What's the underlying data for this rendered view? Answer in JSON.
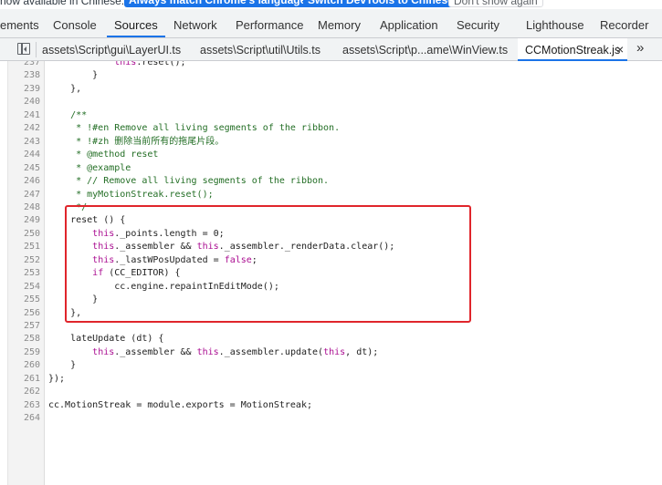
{
  "banner": {
    "text": "now available in Chinese.",
    "match_label": "Always match Chrome's language",
    "switch_label": "Switch DevTools to Chinese",
    "dismiss_label": "Don't show again"
  },
  "panel_tabs": [
    {
      "label": "ements",
      "active": false
    },
    {
      "label": "Console",
      "active": false
    },
    {
      "label": "Sources",
      "active": true
    },
    {
      "label": "Network",
      "active": false
    },
    {
      "label": "Performance",
      "active": false
    },
    {
      "label": "Memory",
      "active": false
    },
    {
      "label": "Application",
      "active": false
    },
    {
      "label": "Security",
      "active": false
    },
    {
      "label": "Lighthouse",
      "active": false
    },
    {
      "label": "Recorder",
      "active": false
    }
  ],
  "file_tabs": [
    {
      "label": "assets\\Script\\gui\\LayerUI.ts",
      "active": false
    },
    {
      "label": "assets\\Script\\util\\Utils.ts",
      "active": false
    },
    {
      "label": "assets\\Script\\p...ame\\WinView.ts",
      "active": false
    },
    {
      "label": "CCMotionStreak.js",
      "active": true
    }
  ],
  "icons": {
    "close": "×",
    "more": "»"
  },
  "code": {
    "lines": [
      {
        "num": "237",
        "segments": [
          {
            "t": "            ",
            "c": "default"
          },
          {
            "t": "this",
            "c": "keyword"
          },
          {
            "t": ".reset();",
            "c": "default"
          }
        ]
      },
      {
        "num": "238",
        "segments": [
          {
            "t": "        }",
            "c": "default"
          }
        ]
      },
      {
        "num": "239",
        "segments": [
          {
            "t": "    },",
            "c": "default"
          }
        ]
      },
      {
        "num": "240",
        "segments": []
      },
      {
        "num": "241",
        "segments": [
          {
            "t": "    /**",
            "c": "comment"
          }
        ]
      },
      {
        "num": "242",
        "segments": [
          {
            "t": "     * !#en Remove all living segments of the ribbon.",
            "c": "comment"
          }
        ]
      },
      {
        "num": "243",
        "segments": [
          {
            "t": "     * !#zh 删除当前所有的拖尾片段。",
            "c": "comment"
          }
        ]
      },
      {
        "num": "244",
        "segments": [
          {
            "t": "     * @method reset",
            "c": "comment"
          }
        ]
      },
      {
        "num": "245",
        "segments": [
          {
            "t": "     * @example",
            "c": "comment"
          }
        ]
      },
      {
        "num": "246",
        "segments": [
          {
            "t": "     * // Remove all living segments of the ribbon.",
            "c": "comment"
          }
        ]
      },
      {
        "num": "247",
        "segments": [
          {
            "t": "     * myMotionStreak.reset();",
            "c": "comment"
          }
        ]
      },
      {
        "num": "248",
        "segments": [
          {
            "t": "     */",
            "c": "comment"
          }
        ]
      },
      {
        "num": "249",
        "segments": [
          {
            "t": "    reset () {",
            "c": "default"
          }
        ]
      },
      {
        "num": "250",
        "segments": [
          {
            "t": "        ",
            "c": "default"
          },
          {
            "t": "this",
            "c": "keyword"
          },
          {
            "t": "._points.length = 0;",
            "c": "default"
          }
        ]
      },
      {
        "num": "251",
        "segments": [
          {
            "t": "        ",
            "c": "default"
          },
          {
            "t": "this",
            "c": "keyword"
          },
          {
            "t": "._assembler && ",
            "c": "default"
          },
          {
            "t": "this",
            "c": "keyword"
          },
          {
            "t": "._assembler._renderData.clear();",
            "c": "default"
          }
        ]
      },
      {
        "num": "252",
        "segments": [
          {
            "t": "        ",
            "c": "default"
          },
          {
            "t": "this",
            "c": "keyword"
          },
          {
            "t": "._lastWPosUpdated = ",
            "c": "default"
          },
          {
            "t": "false",
            "c": "keyword"
          },
          {
            "t": ";",
            "c": "default"
          }
        ]
      },
      {
        "num": "253",
        "segments": [
          {
            "t": "        ",
            "c": "default"
          },
          {
            "t": "if",
            "c": "keyword"
          },
          {
            "t": " (CC_EDITOR) {",
            "c": "default"
          }
        ]
      },
      {
        "num": "254",
        "segments": [
          {
            "t": "            cc.engine.repaintInEditMode();",
            "c": "default"
          }
        ]
      },
      {
        "num": "255",
        "segments": [
          {
            "t": "        }",
            "c": "default"
          }
        ]
      },
      {
        "num": "256",
        "segments": [
          {
            "t": "    },",
            "c": "default"
          }
        ]
      },
      {
        "num": "257",
        "segments": []
      },
      {
        "num": "258",
        "segments": [
          {
            "t": "    lateUpdate (dt) {",
            "c": "default"
          }
        ]
      },
      {
        "num": "259",
        "segments": [
          {
            "t": "        ",
            "c": "default"
          },
          {
            "t": "this",
            "c": "keyword"
          },
          {
            "t": "._assembler && ",
            "c": "default"
          },
          {
            "t": "this",
            "c": "keyword"
          },
          {
            "t": "._assembler.update(",
            "c": "default"
          },
          {
            "t": "this",
            "c": "keyword"
          },
          {
            "t": ", dt);",
            "c": "default"
          }
        ]
      },
      {
        "num": "260",
        "segments": [
          {
            "t": "    }",
            "c": "default"
          }
        ]
      },
      {
        "num": "261",
        "segments": [
          {
            "t": "});",
            "c": "default"
          }
        ]
      },
      {
        "num": "262",
        "segments": []
      },
      {
        "num": "263",
        "segments": [
          {
            "t": "cc.MotionStreak = module.exports = MotionStreak;",
            "c": "default"
          }
        ]
      },
      {
        "num": "264",
        "segments": []
      }
    ]
  },
  "colors": {
    "accent": "#1a73e8",
    "highlight_box": "#e0252b",
    "comment": "#236e25",
    "keyword": "#aa0d91"
  }
}
